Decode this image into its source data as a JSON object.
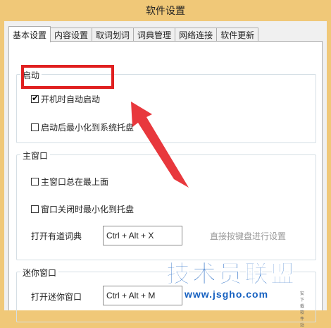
{
  "window": {
    "title": "软件设置"
  },
  "tabs": [
    "基本设置",
    "内容设置",
    "取词划词",
    "词典管理",
    "网络连接",
    "软件更新"
  ],
  "startup": {
    "title": "启动",
    "auto_start_label": "开机时自动启动",
    "auto_start_checked": true,
    "minimize_tray_label": "启动后最小化到系统托盘",
    "minimize_tray_checked": false
  },
  "main_window": {
    "title": "主窗口",
    "always_top_label": "主窗口总在最上面",
    "always_top_checked": false,
    "close_to_tray_label": "窗口关闭时最小化到托盘",
    "close_to_tray_checked": false,
    "open_dict_label": "打开有道词典",
    "open_dict_hotkey": "Ctrl + Alt + X",
    "hotkey_hint": "直接按键盘进行设置"
  },
  "mini_window": {
    "title": "迷你窗口",
    "open_mini_label": "打开迷你窗口",
    "open_mini_hotkey": "Ctrl + Alt + M"
  },
  "watermark": {
    "brand": "技术员联盟",
    "url": "www.jsgho.com",
    "tagline": "安下载软件站"
  },
  "colors": {
    "highlight": "#e02020",
    "arrow": "#e8383d",
    "watermark": "#1560c0"
  }
}
